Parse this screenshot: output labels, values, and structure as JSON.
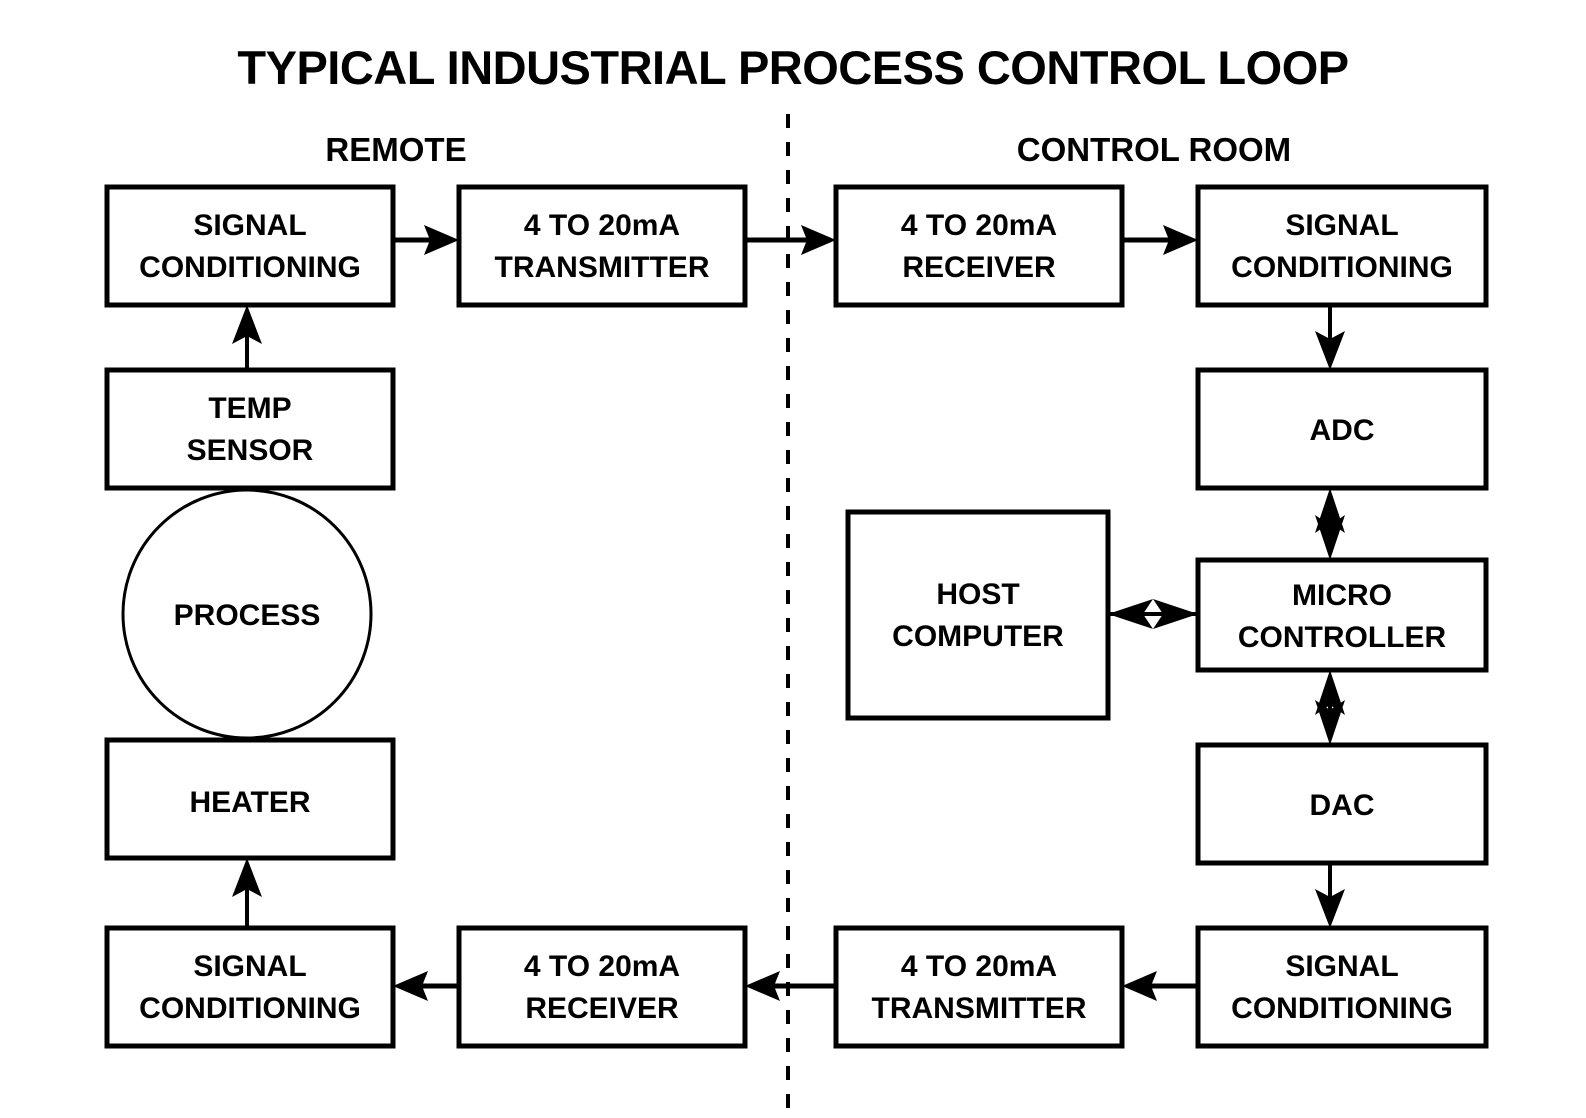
{
  "title": "TYPICAL INDUSTRIAL PROCESS CONTROL LOOP",
  "sections": {
    "left": "REMOTE",
    "right": "CONTROL ROOM"
  },
  "colors": {
    "stroke": "#000000",
    "background": "#ffffff"
  },
  "blocks": {
    "remote_signal_conditioning_in": {
      "line1": "SIGNAL",
      "line2": "CONDITIONING"
    },
    "remote_transmitter": {
      "line1": "4 TO 20mA",
      "line2": "TRANSMITTER"
    },
    "control_receiver": {
      "line1": "4 TO 20mA",
      "line2": "RECEIVER"
    },
    "control_signal_conditioning_in": {
      "line1": "SIGNAL",
      "line2": "CONDITIONING"
    },
    "temp_sensor": {
      "line1": "TEMP",
      "line2": "SENSOR"
    },
    "process": {
      "line1": "PROCESS"
    },
    "heater": {
      "line1": "HEATER"
    },
    "adc": {
      "line1": "ADC"
    },
    "host_computer": {
      "line1": "HOST",
      "line2": "COMPUTER"
    },
    "micro_controller": {
      "line1": "MICRO",
      "line2": "CONTROLLER"
    },
    "dac": {
      "line1": "DAC"
    },
    "control_signal_conditioning_out": {
      "line1": "SIGNAL",
      "line2": "CONDITIONING"
    },
    "control_transmitter": {
      "line1": "4 TO 20mA",
      "line2": "TRANSMITTER"
    },
    "remote_receiver": {
      "line1": "4 TO 20mA",
      "line2": "RECEIVER"
    },
    "remote_signal_conditioning_out": {
      "line1": "SIGNAL",
      "line2": "CONDITIONING"
    }
  },
  "chart_data": {
    "type": "diagram",
    "title": "TYPICAL INDUSTRIAL PROCESS CONTROL LOOP",
    "nodes": [
      {
        "id": "remote_signal_conditioning_in",
        "label": "SIGNAL CONDITIONING",
        "shape": "rect",
        "zone": "REMOTE"
      },
      {
        "id": "remote_transmitter",
        "label": "4 TO 20mA TRANSMITTER",
        "shape": "rect",
        "zone": "REMOTE"
      },
      {
        "id": "temp_sensor",
        "label": "TEMP SENSOR",
        "shape": "rect",
        "zone": "REMOTE"
      },
      {
        "id": "process",
        "label": "PROCESS",
        "shape": "circle",
        "zone": "REMOTE"
      },
      {
        "id": "heater",
        "label": "HEATER",
        "shape": "rect",
        "zone": "REMOTE"
      },
      {
        "id": "remote_signal_conditioning_out",
        "label": "SIGNAL CONDITIONING",
        "shape": "rect",
        "zone": "REMOTE"
      },
      {
        "id": "remote_receiver",
        "label": "4 TO 20mA RECEIVER",
        "shape": "rect",
        "zone": "REMOTE"
      },
      {
        "id": "control_receiver",
        "label": "4 TO 20mA RECEIVER",
        "shape": "rect",
        "zone": "CONTROL ROOM"
      },
      {
        "id": "control_signal_conditioning_in",
        "label": "SIGNAL CONDITIONING",
        "shape": "rect",
        "zone": "CONTROL ROOM"
      },
      {
        "id": "adc",
        "label": "ADC",
        "shape": "rect",
        "zone": "CONTROL ROOM"
      },
      {
        "id": "host_computer",
        "label": "HOST COMPUTER",
        "shape": "rect",
        "zone": "CONTROL ROOM"
      },
      {
        "id": "micro_controller",
        "label": "MICRO CONTROLLER",
        "shape": "rect",
        "zone": "CONTROL ROOM"
      },
      {
        "id": "dac",
        "label": "DAC",
        "shape": "rect",
        "zone": "CONTROL ROOM"
      },
      {
        "id": "control_signal_conditioning_out",
        "label": "SIGNAL CONDITIONING",
        "shape": "rect",
        "zone": "CONTROL ROOM"
      },
      {
        "id": "control_transmitter",
        "label": "4 TO 20mA TRANSMITTER",
        "shape": "rect",
        "zone": "CONTROL ROOM"
      }
    ],
    "edges": [
      {
        "from": "temp_sensor",
        "to": "remote_signal_conditioning_in",
        "direction": "single"
      },
      {
        "from": "remote_signal_conditioning_in",
        "to": "remote_transmitter",
        "direction": "single"
      },
      {
        "from": "remote_transmitter",
        "to": "control_receiver",
        "direction": "single"
      },
      {
        "from": "control_receiver",
        "to": "control_signal_conditioning_in",
        "direction": "single"
      },
      {
        "from": "control_signal_conditioning_in",
        "to": "adc",
        "direction": "single"
      },
      {
        "from": "adc",
        "to": "micro_controller",
        "direction": "double"
      },
      {
        "from": "host_computer",
        "to": "micro_controller",
        "direction": "double"
      },
      {
        "from": "micro_controller",
        "to": "dac",
        "direction": "double"
      },
      {
        "from": "dac",
        "to": "control_signal_conditioning_out",
        "direction": "single"
      },
      {
        "from": "control_signal_conditioning_out",
        "to": "control_transmitter",
        "direction": "single"
      },
      {
        "from": "control_transmitter",
        "to": "remote_receiver",
        "direction": "single"
      },
      {
        "from": "remote_receiver",
        "to": "remote_signal_conditioning_out",
        "direction": "single"
      },
      {
        "from": "remote_signal_conditioning_out",
        "to": "heater",
        "direction": "single"
      }
    ],
    "divider": {
      "label_left": "REMOTE",
      "label_right": "CONTROL ROOM",
      "style": "dashed-vertical"
    }
  }
}
